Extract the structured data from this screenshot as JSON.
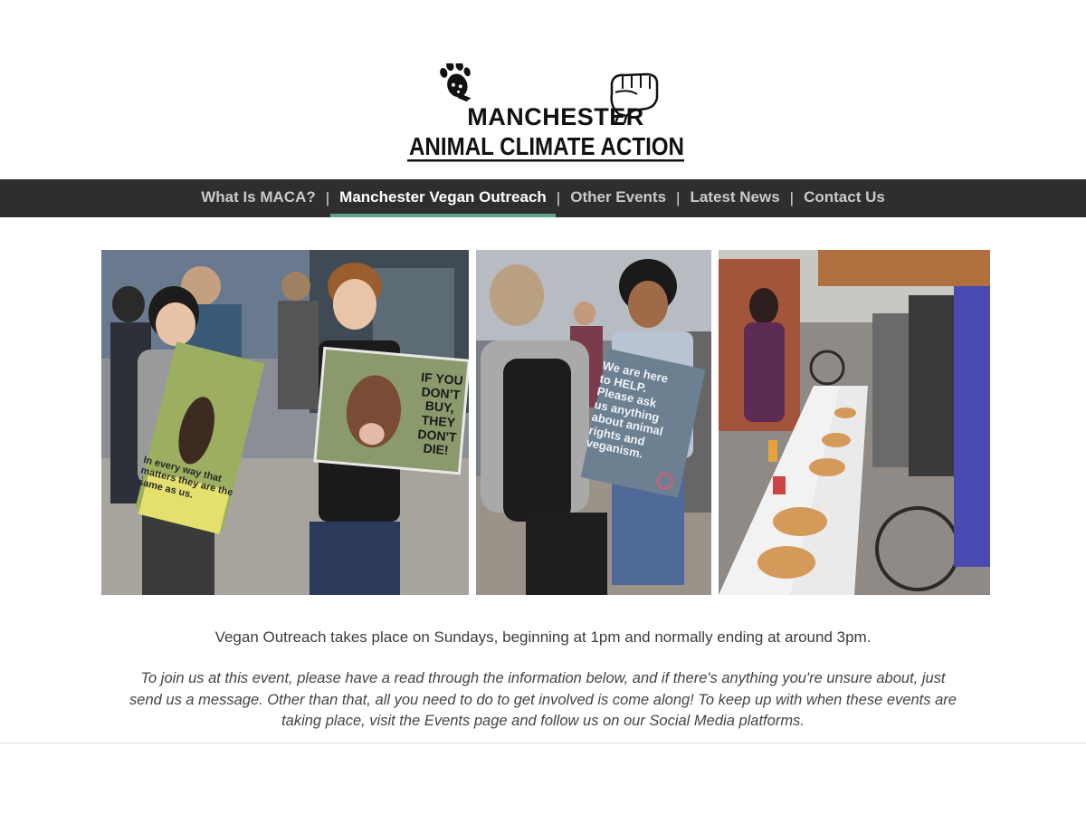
{
  "logo": {
    "line1": "MANCHESTER",
    "line2": "ANIMAL CLIMATE ACTION",
    "icons": [
      "paw-icon",
      "raised-fist-icon"
    ]
  },
  "nav": {
    "items": [
      {
        "label": "What Is MACA?"
      },
      {
        "label": "Manchester Vegan Outreach",
        "active": true
      },
      {
        "label": "Other Events"
      },
      {
        "label": "Latest News"
      },
      {
        "label": "Contact Us"
      }
    ],
    "separator": "|",
    "active_underline_color": "#5fa387",
    "bar_color": "#2e2e2e"
  },
  "photos": {
    "photo1": {
      "sign_left": "In every way that\nmatters they are the\nsame as us.",
      "sign_right": "IF YOU\nDON'T BUY,\nTHEY\nDON'T DIE!"
    },
    "photo2": {
      "sign": "We are here\nto HELP.\nPlease ask\nus anything\nabout animal\nrights and\nveganism."
    }
  },
  "main": {
    "lead": "Vegan Outreach takes place on Sundays, beginning at 1pm and normally ending at around 3pm.",
    "note": "To join us at this event, please have a read through the information below, and if there's anything you're unsure about, just send us a message. Other than that, all you need to do to get involved is come along! To keep up with when these events are taking place, visit the Events page and follow us on our Social Media platforms."
  }
}
